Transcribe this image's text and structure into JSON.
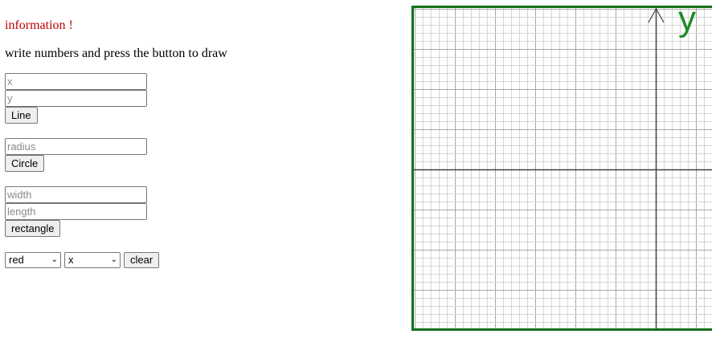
{
  "info": {
    "title": "information !",
    "instructions": "write numbers and press the button to draw"
  },
  "line": {
    "x_placeholder": "x",
    "y_placeholder": "y",
    "button": "Line"
  },
  "circle": {
    "radius_placeholder": "radius",
    "button": "Circle"
  },
  "rectangle": {
    "width_placeholder": "width",
    "length_placeholder": "length",
    "button": "rectangle"
  },
  "controls": {
    "color_value": "red",
    "axis_value": "x",
    "clear_button": "clear"
  },
  "canvas": {
    "axis_label": "y",
    "border_color": "#137018",
    "axis_label_color": "#1e8c28"
  }
}
